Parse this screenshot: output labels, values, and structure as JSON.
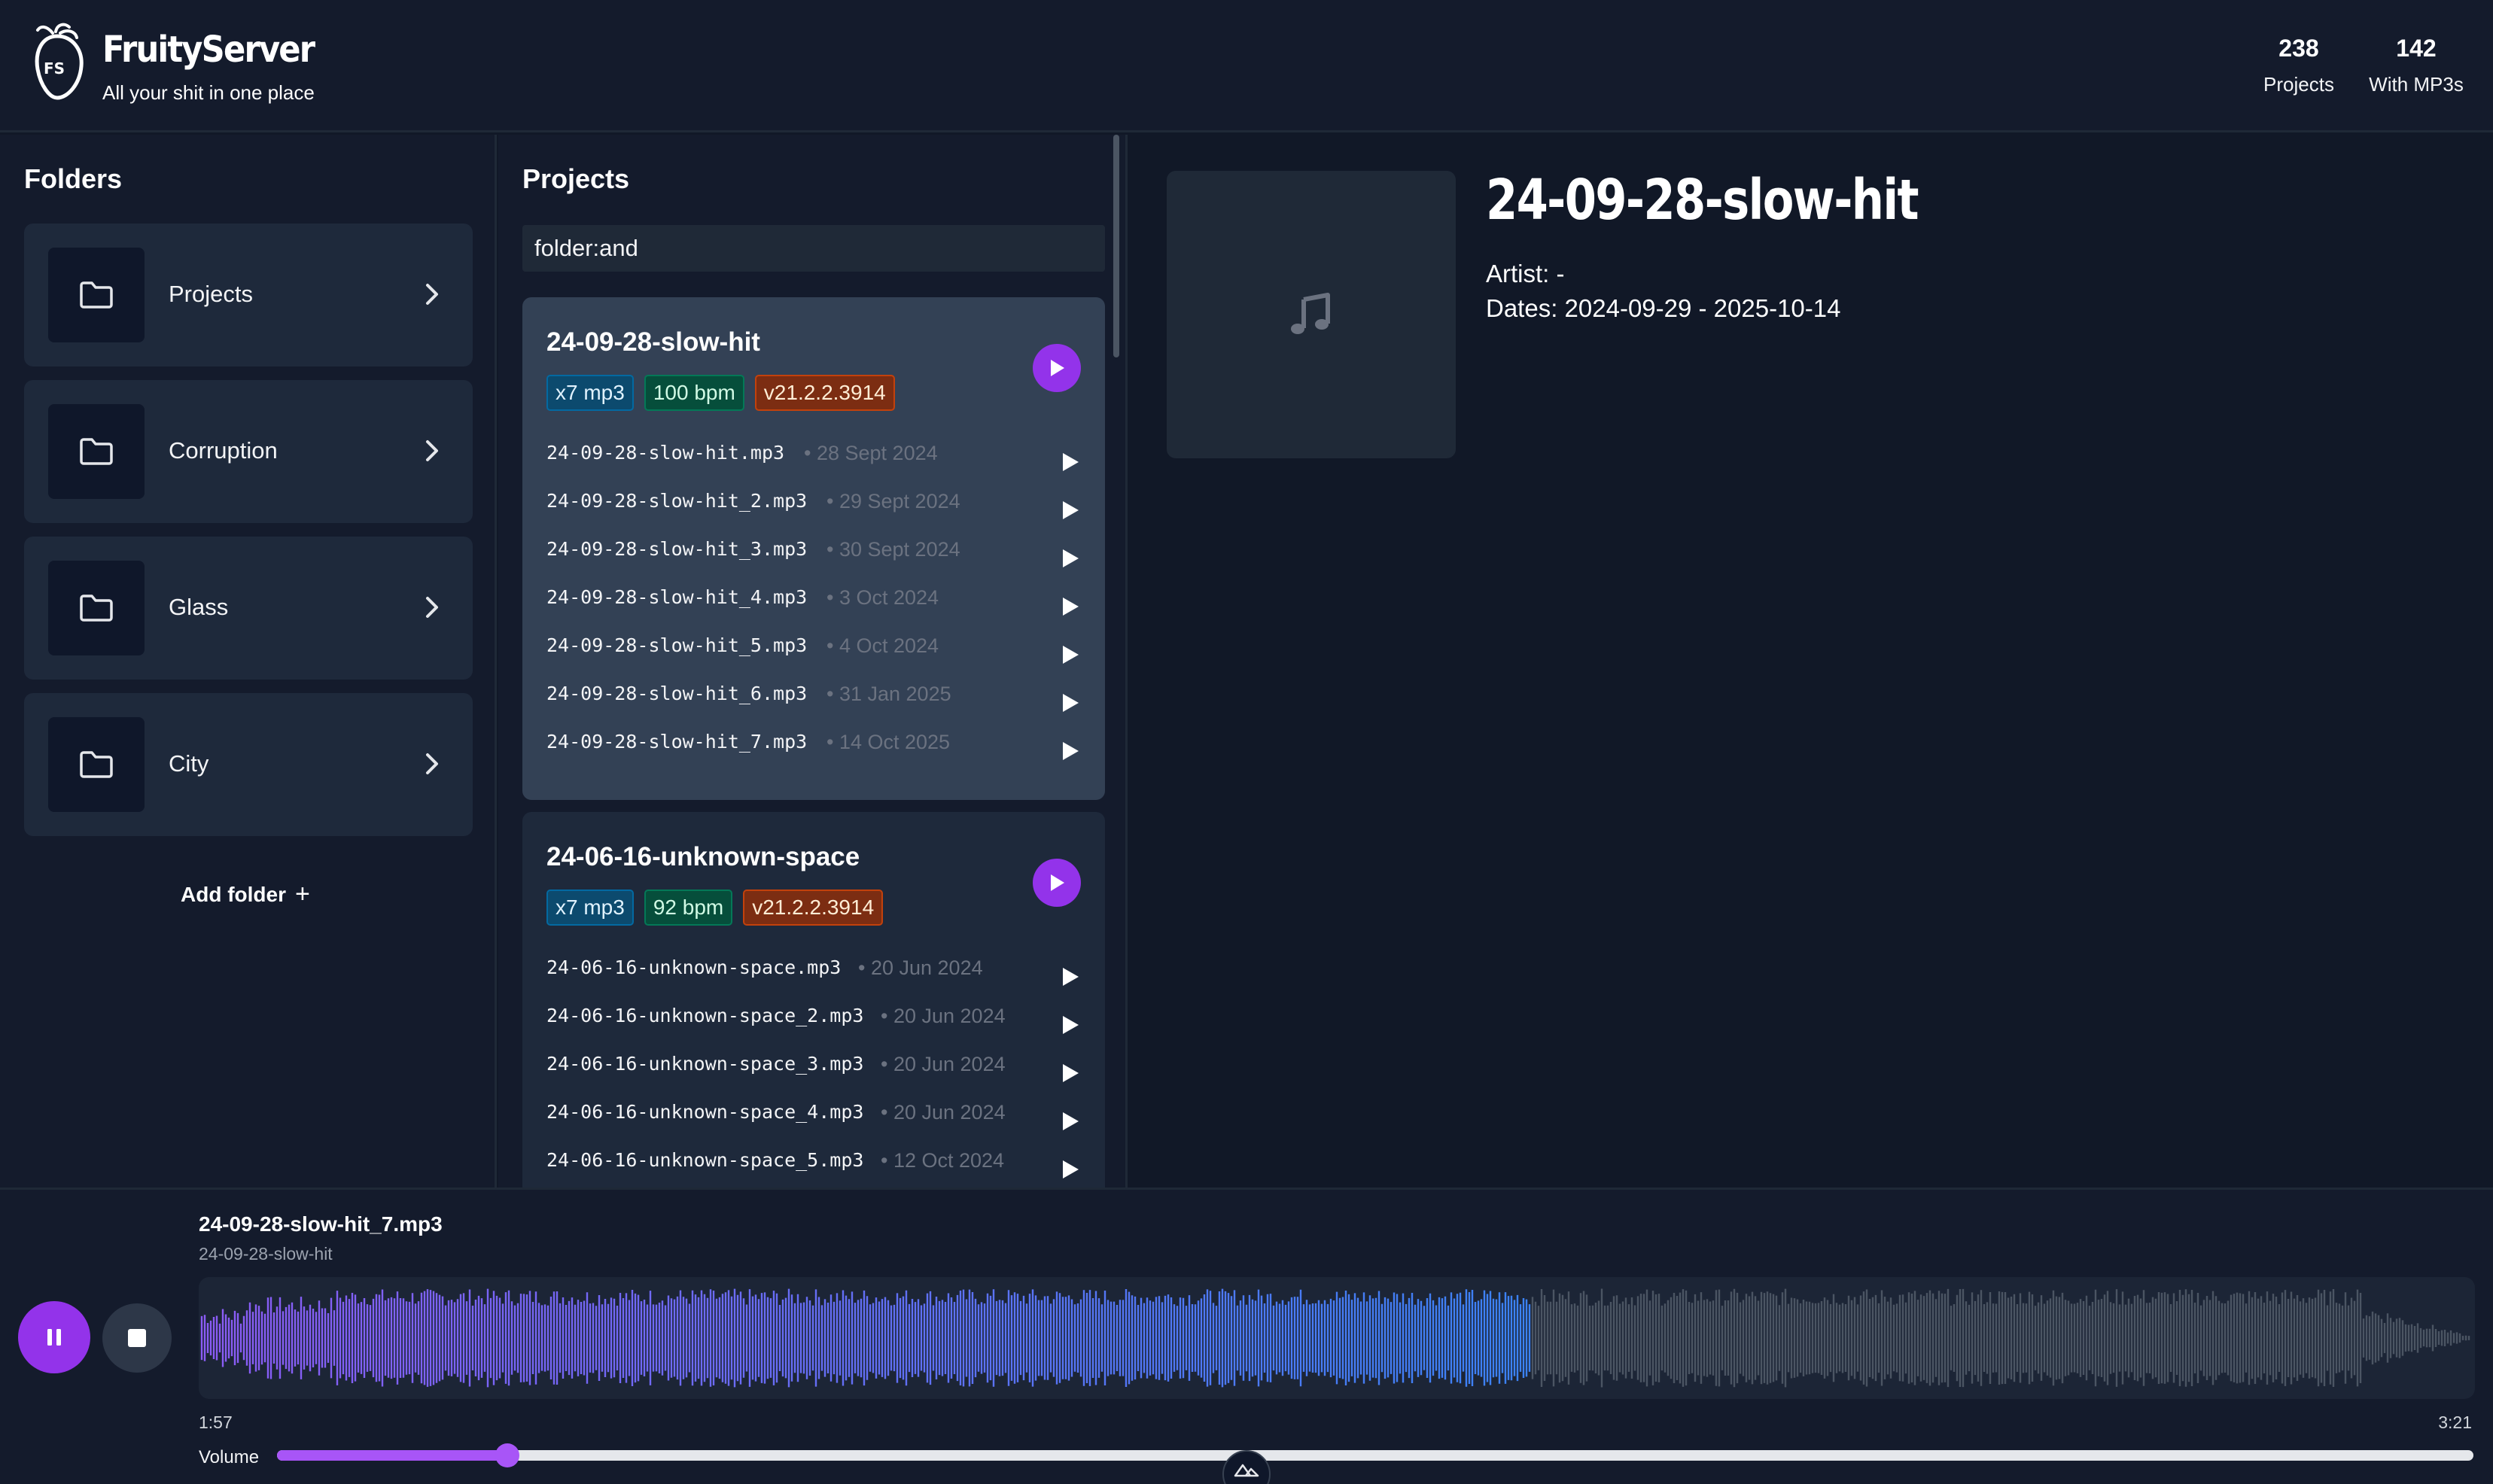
{
  "header": {
    "logo_label": "FS",
    "title": "FruityServer",
    "tagline": "All your shit in one place",
    "stats": [
      {
        "value": "238",
        "label": "Projects"
      },
      {
        "value": "142",
        "label": "With MP3s"
      }
    ]
  },
  "folders": {
    "title": "Folders",
    "items": [
      {
        "label": "Projects"
      },
      {
        "label": "Corruption"
      },
      {
        "label": "Glass"
      },
      {
        "label": "City"
      }
    ],
    "add_label": "Add folder",
    "add_symbol": "+"
  },
  "projects": {
    "title": "Projects",
    "search_value": "folder:and",
    "cards": [
      {
        "name": "24-09-28-slow-hit",
        "badges": {
          "mp3": "x7 mp3",
          "bpm": "100 bpm",
          "version": "v21.2.2.3914"
        },
        "files": [
          {
            "name": "24-09-28-slow-hit.mp3",
            "sep": "•",
            "date": "28 Sept 2024"
          },
          {
            "name": "24-09-28-slow-hit_2.mp3",
            "sep": "•",
            "date": "29 Sept 2024"
          },
          {
            "name": "24-09-28-slow-hit_3.mp3",
            "sep": "•",
            "date": "30 Sept 2024"
          },
          {
            "name": "24-09-28-slow-hit_4.mp3",
            "sep": "•",
            "date": "3 Oct 2024"
          },
          {
            "name": "24-09-28-slow-hit_5.mp3",
            "sep": "•",
            "date": "4 Oct 2024"
          },
          {
            "name": "24-09-28-slow-hit_6.mp3",
            "sep": "•",
            "date": "31 Jan 2025"
          },
          {
            "name": "24-09-28-slow-hit_7.mp3",
            "sep": "•",
            "date": "14 Oct 2025"
          }
        ]
      },
      {
        "name": "24-06-16-unknown-space",
        "badges": {
          "mp3": "x7 mp3",
          "bpm": "92 bpm",
          "version": "v21.2.2.3914"
        },
        "files": [
          {
            "name": "24-06-16-unknown-space.mp3",
            "sep": "•",
            "date": "20 Jun 2024"
          },
          {
            "name": "24-06-16-unknown-space_2.mp3",
            "sep": "•",
            "date": "20 Jun 2024"
          },
          {
            "name": "24-06-16-unknown-space_3.mp3",
            "sep": "•",
            "date": "20 Jun 2024"
          },
          {
            "name": "24-06-16-unknown-space_4.mp3",
            "sep": "•",
            "date": "20 Jun 2024"
          },
          {
            "name": "24-06-16-unknown-space_5.mp3",
            "sep": "•",
            "date": "12 Oct 2024"
          }
        ]
      }
    ]
  },
  "detail": {
    "title": "24-09-28-slow-hit",
    "artist": "Artist: -",
    "dates": "Dates: 2024-09-29 - 2025-10-14",
    "cover_icon": "music-note-icon"
  },
  "player": {
    "track_title": "24-09-28-slow-hit_7.mp3",
    "track_project": "24-09-28-slow-hit",
    "current_time": "1:57",
    "total_time": "3:21",
    "progress": 0.585,
    "volume_label": "Volume",
    "volume": 0.105,
    "state": "playing"
  },
  "colors": {
    "accent": "#9333ea",
    "wave_played_start": "#8b5cf6",
    "wave_played_end": "#3b82f6",
    "wave_unplayed": "#4b5563",
    "background": "#111827"
  }
}
